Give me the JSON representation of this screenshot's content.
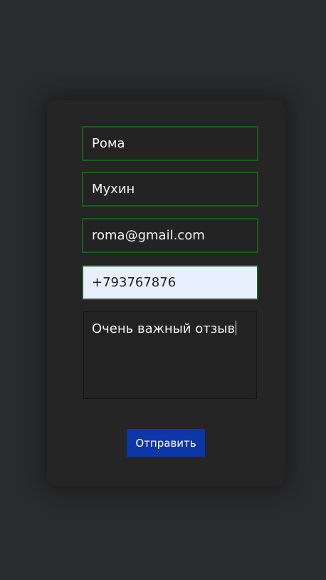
{
  "form": {
    "first_name": "Рома",
    "last_name": "Мухин",
    "email": "roma@gmail.com",
    "phone": "+793767876",
    "message": "Очень важный отзыв",
    "submit_label": "Отправить"
  },
  "colors": {
    "background": "#2a2b2d",
    "card": "#252525",
    "field_border": "#1c5c1c",
    "focused_field_bg": "#e8effc",
    "button": "#0d36a6"
  }
}
